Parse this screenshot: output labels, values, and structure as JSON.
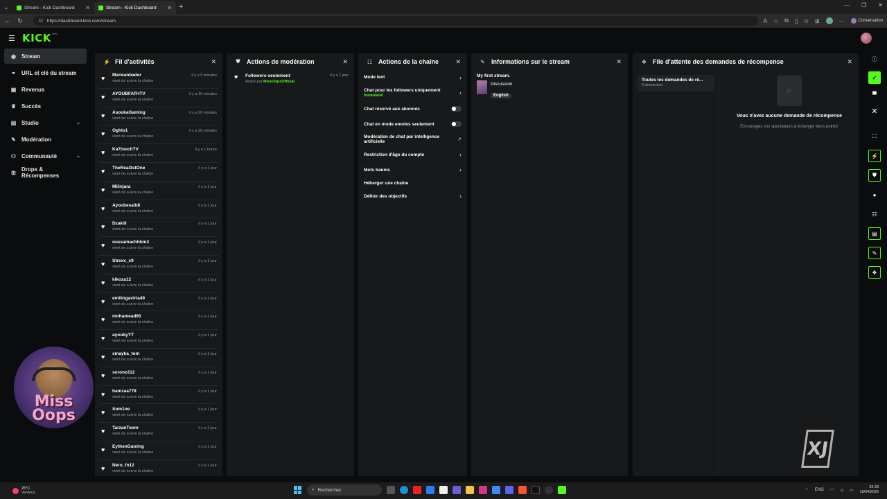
{
  "browser": {
    "tabs": [
      {
        "title": "Stream - Kick Dashboard",
        "active": false
      },
      {
        "title": "Stream - Kick Dashboard",
        "active": true
      }
    ],
    "url": "https://dashboard.kick.com/stream",
    "copilot_label": "Conversation"
  },
  "app": {
    "logo": "KICK",
    "logo_badge": "beta"
  },
  "sidebar": {
    "items": [
      {
        "label": "Stream",
        "icon": "broadcast-icon",
        "active": true
      },
      {
        "label": "URL et clé du stream",
        "icon": "link-icon"
      },
      {
        "label": "Revenus",
        "icon": "wallet-icon"
      },
      {
        "label": "Succès",
        "icon": "trophy-icon"
      },
      {
        "label": "Studio",
        "icon": "studio-icon",
        "expandable": true
      },
      {
        "label": "Modération",
        "icon": "wrench-icon"
      },
      {
        "label": "Communauté",
        "icon": "users-icon",
        "expandable": true
      },
      {
        "label": "Drops & Récompenses",
        "icon": "gift-icon"
      }
    ],
    "webcam_overlay_text": "Miss Oops"
  },
  "activity_panel": {
    "title": "Fil d'activités",
    "items": [
      {
        "name": "Marwanbader",
        "action": "vient de suivre la chaîne",
        "time": "il y a 9 minutes"
      },
      {
        "name": "AYOUBFATHTV",
        "action": "vient de suivre la chaîne",
        "time": "il y a 10 minutes"
      },
      {
        "name": "AsoukaGaming",
        "action": "vient de suivre la chaîne",
        "time": "il y a 20 minutes"
      },
      {
        "name": "Oghlo1",
        "action": "vient de suivre la chaîne",
        "time": "il y a 25 minutes"
      },
      {
        "name": "Ka7touchTV",
        "action": "vient de suivre la chaîne",
        "time": "il y a 1 heure"
      },
      {
        "name": "TheReal3stOne",
        "action": "vient de suivre la chaîne",
        "time": "il y a 1 jour"
      },
      {
        "name": "Miiinjara",
        "action": "vient de suivre la chaîne",
        "time": "il y a 1 jour"
      },
      {
        "name": "Ayoubesa3di",
        "action": "vient de suivre la chaîne",
        "time": "il y a 1 jour"
      },
      {
        "name": "Dzakiil",
        "action": "vient de suivre la chaîne",
        "time": "il y a 1 jour"
      },
      {
        "name": "oussamachhbin3",
        "action": "vient de suivre la chaîne",
        "time": "il y a 1 jour"
      },
      {
        "name": "Strexx_x9",
        "action": "vient de suivre la chaîne",
        "time": "il y a 1 jour"
      },
      {
        "name": "kikoza12",
        "action": "vient de suivre la chaîne",
        "time": "il y a 1 jour"
      },
      {
        "name": "emiliogaviria49",
        "action": "vient de suivre la chaîne",
        "time": "il y a 1 jour"
      },
      {
        "name": "mohamead65",
        "action": "vient de suivre la chaîne",
        "time": "il y a 1 jour"
      },
      {
        "name": "ayoubyYT",
        "action": "vient de suivre la chaîne",
        "time": "il y a 1 jour"
      },
      {
        "name": "smayka_tom",
        "action": "vient de suivre la chaîne",
        "time": "il y a 1 jour"
      },
      {
        "name": "sorono112",
        "action": "vient de suivre la chaîne",
        "time": "il y a 1 jour"
      },
      {
        "name": "hamzaa778",
        "action": "vient de suivre la chaîne",
        "time": "il y a 1 jour"
      },
      {
        "name": "Som1ne",
        "action": "vient de suivre la chaîne",
        "time": "il y a 1 jour"
      },
      {
        "name": "TarzanToom",
        "action": "vient de suivre la chaîne",
        "time": "il y a 1 jour"
      },
      {
        "name": "EythenGaming",
        "action": "vient de suivre la chaîne",
        "time": "il y a 1 jour"
      },
      {
        "name": "Nero_fn12",
        "action": "vient de suivre la chaîne",
        "time": "il y a 1 jour"
      }
    ]
  },
  "moderation_panel": {
    "title": "Actions de modération",
    "items": [
      {
        "name": "Followers-seulement",
        "prefix": "Activé par",
        "actor": "MissOopsOfficial",
        "time": "il y a 1 jour"
      }
    ]
  },
  "channel_panel": {
    "title": "Actions de la chaîne",
    "items": [
      {
        "label": "Mode lent",
        "control": "chevron"
      },
      {
        "label": "Chat pour les followers uniquement",
        "sub": "Instantané",
        "control": "chevron"
      },
      {
        "label": "Chat réservé aux abonnés",
        "control": "toggle",
        "on": false
      },
      {
        "label": "Chat en mode emotes seulement",
        "control": "toggle",
        "on": false
      },
      {
        "label": "Modération de chat par intelligence artificielle",
        "control": "external"
      },
      {
        "label": "Restriction d'âge du compte",
        "control": "chevron"
      },
      {
        "label": "Mots bannis",
        "control": "chevron"
      },
      {
        "label": "Héberger une chaîne",
        "control": "none"
      },
      {
        "label": "Définir des objectifs",
        "control": "chevron"
      }
    ]
  },
  "stream_info_panel": {
    "title": "Informations sur le stream",
    "stream_title": "My first stream.",
    "category": "Discussion",
    "language": "English"
  },
  "rewards_panel": {
    "title": "File d'attente des demandes de récompense",
    "card_title": "Toutes les demandes de ré...",
    "card_count": "0 demandes",
    "empty_title": "Vous n'avez aucune demande de récompense",
    "empty_sub": "Encouragez vos spectateurs à échanger leurs points!"
  },
  "right_rail": {
    "buttons": [
      {
        "icon": "info-icon",
        "style": "plain"
      },
      {
        "icon": "check-icon",
        "style": "filled"
      },
      {
        "icon": "layout-icon",
        "style": "plain"
      },
      {
        "icon": "close-icon",
        "style": "plain"
      },
      {
        "icon": "expand-icon",
        "style": "plain"
      },
      {
        "icon": "activity-icon",
        "style": "outline"
      },
      {
        "icon": "shield-icon",
        "style": "outline"
      },
      {
        "icon": "chat-icon",
        "style": "plain"
      },
      {
        "icon": "sliders-icon",
        "style": "plain"
      },
      {
        "icon": "info-card-icon",
        "style": "outline"
      },
      {
        "icon": "wrench-icon",
        "style": "outline"
      },
      {
        "icon": "rewards-icon",
        "style": "outline"
      }
    ]
  },
  "taskbar": {
    "temperature": "25°C",
    "weather": "Venteux",
    "search_placeholder": "Rechercher",
    "language": "ENG",
    "time": "23:28",
    "date": "18/04/2026"
  }
}
